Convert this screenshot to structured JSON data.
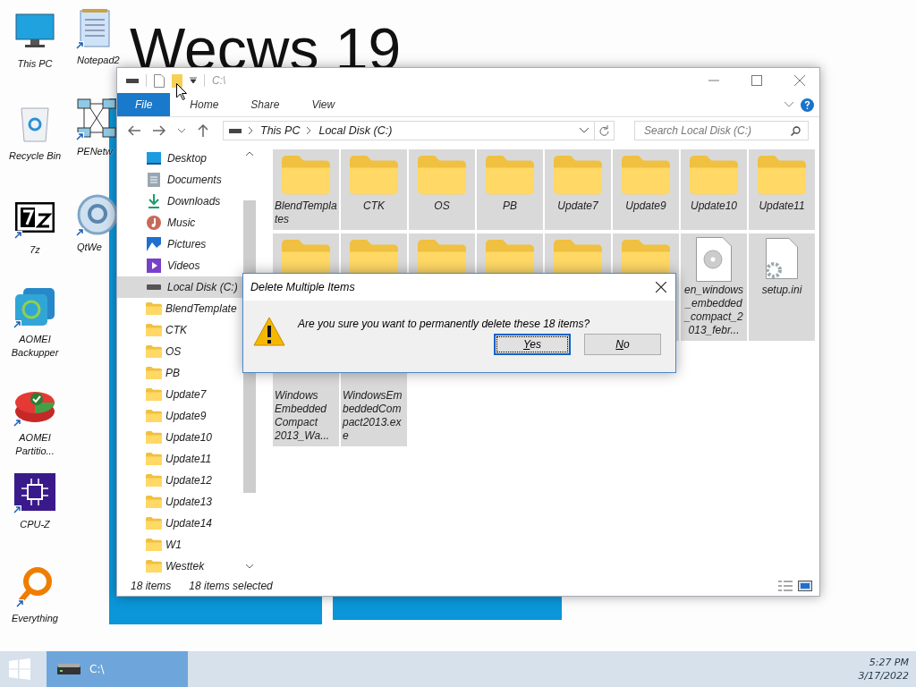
{
  "wallpaper_text": "Wecws 19",
  "desktop_icons": [
    {
      "label": "This PC",
      "kind": "monitor",
      "shortcut": false
    },
    {
      "label": "Recycle Bin",
      "kind": "recycle",
      "shortcut": false
    },
    {
      "label": "7z",
      "kind": "sevenzip",
      "shortcut": true
    },
    {
      "label": "AOMEI Backupper",
      "kind": "backup",
      "shortcut": true
    },
    {
      "label": "AOMEI Partitio...",
      "kind": "partition",
      "shortcut": true
    },
    {
      "label": "CPU-Z",
      "kind": "chip",
      "shortcut": true
    },
    {
      "label": "Everything",
      "kind": "magnifier",
      "shortcut": true
    },
    {
      "label": "Notepad2",
      "kind": "notepad",
      "shortcut": true
    },
    {
      "label": "PENetw",
      "kind": "network",
      "shortcut": true
    },
    {
      "label": "QtWe",
      "kind": "qt",
      "shortcut": true
    }
  ],
  "window": {
    "title": "C:\\",
    "ribbon_tabs": [
      {
        "label": "File",
        "selected": true
      },
      {
        "label": "Home",
        "selected": false
      },
      {
        "label": "Share",
        "selected": false
      },
      {
        "label": "View",
        "selected": false
      }
    ],
    "address": [
      "This PC",
      "Local Disk (C:)"
    ],
    "search": {
      "placeholder": "Search Local Disk (C:)"
    },
    "nav": [
      {
        "label": "Desktop",
        "kind": "desktop",
        "selected": false
      },
      {
        "label": "Documents",
        "kind": "documents",
        "selected": false
      },
      {
        "label": "Downloads",
        "kind": "downloads",
        "selected": false
      },
      {
        "label": "Music",
        "kind": "music",
        "selected": false
      },
      {
        "label": "Pictures",
        "kind": "pictures",
        "selected": false
      },
      {
        "label": "Videos",
        "kind": "videos",
        "selected": false
      },
      {
        "label": "Local Disk (C:)",
        "kind": "drive",
        "selected": true,
        "children": [
          {
            "label": "BlendTemplate",
            "kind": "folder",
            "selected": false
          },
          {
            "label": "CTK",
            "kind": "folder",
            "selected": false
          },
          {
            "label": "OS",
            "kind": "folder",
            "selected": false
          },
          {
            "label": "PB",
            "kind": "folder",
            "selected": false
          },
          {
            "label": "Update7",
            "kind": "folder",
            "selected": false
          },
          {
            "label": "Update9",
            "kind": "folder",
            "selected": false
          },
          {
            "label": "Update10",
            "kind": "folder",
            "selected": false
          },
          {
            "label": "Update11",
            "kind": "folder",
            "selected": false
          },
          {
            "label": "Update12",
            "kind": "folder",
            "selected": false
          },
          {
            "label": "Update13",
            "kind": "folder",
            "selected": false
          },
          {
            "label": "Update14",
            "kind": "folder",
            "selected": false
          },
          {
            "label": "W1",
            "kind": "folder",
            "selected": false
          },
          {
            "label": "Westtek",
            "kind": "folder",
            "selected": false
          }
        ]
      }
    ],
    "files": [
      {
        "name": "BlendTemplates",
        "kind": "folder",
        "selected": true
      },
      {
        "name": "CTK",
        "kind": "folder",
        "selected": true
      },
      {
        "name": "OS",
        "kind": "folder",
        "selected": true
      },
      {
        "name": "PB",
        "kind": "folder",
        "selected": true
      },
      {
        "name": "Update7",
        "kind": "folder",
        "selected": true
      },
      {
        "name": "Update9",
        "kind": "folder",
        "selected": true
      },
      {
        "name": "Update10",
        "kind": "folder",
        "selected": true
      },
      {
        "name": "Update11",
        "kind": "folder",
        "selected": true
      },
      {
        "kind": "folder",
        "selected": true
      },
      {
        "kind": "folder",
        "selected": true
      },
      {
        "kind": "folder",
        "selected": true
      },
      {
        "kind": "folder",
        "selected": true
      },
      {
        "kind": "folder",
        "selected": true
      },
      {
        "kind": "folder",
        "selected": true
      },
      {
        "name": "en_windows_embedded_compact_2013_febr...",
        "kind": "disc",
        "selected": true
      },
      {
        "name": "setup.ini",
        "kind": "settings",
        "selected": true
      },
      {
        "name": "Windows Embedded Compact 2013_Wa...",
        "selected": true
      },
      {
        "name": "WindowsEmbeddedCompact2013.exe",
        "selected": true
      }
    ],
    "status": {
      "count": "18 items",
      "selection": "18 items selected"
    }
  },
  "dialog": {
    "title": "Delete Multiple Items",
    "message": "Are you sure you want to permanently delete these 18 items?",
    "buttons": [
      {
        "label": "Yes",
        "focused": true
      },
      {
        "label": "No",
        "focused": false
      }
    ]
  },
  "taskbar": {
    "tasks": [
      {
        "label": "C:\\",
        "selected": true
      }
    ],
    "time": "5:27 PM",
    "date": "3/17/2022"
  }
}
